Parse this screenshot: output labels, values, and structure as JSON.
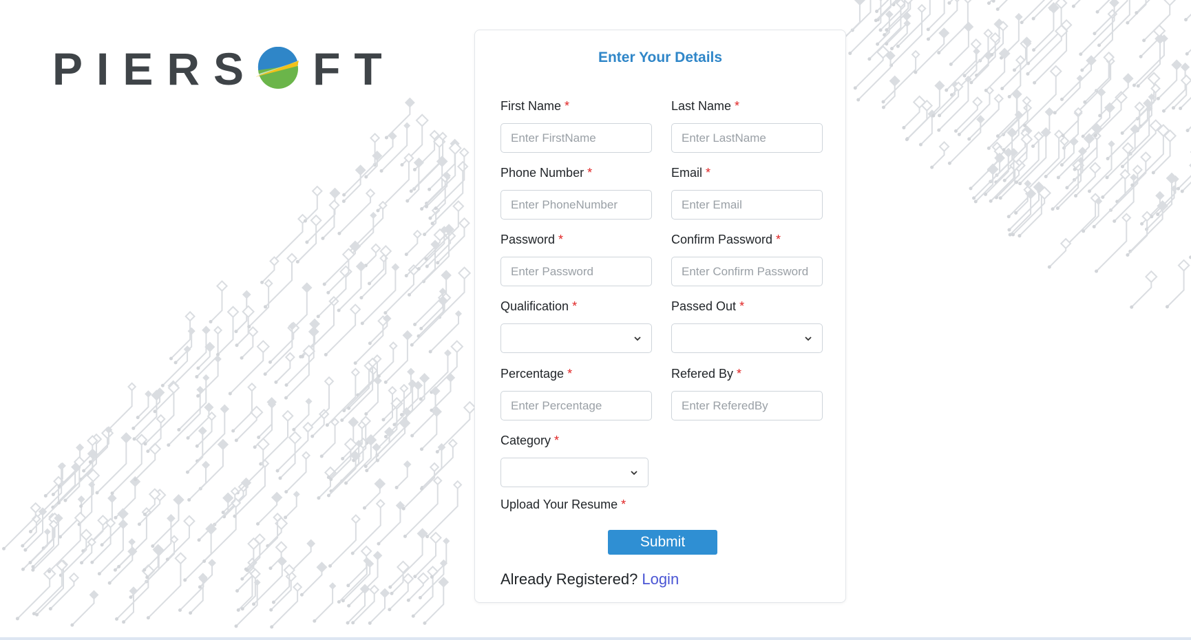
{
  "brand": {
    "logo_text_left": "PIERS",
    "logo_text_right": "FT",
    "colors": {
      "text": "#3f4448",
      "globe_blue": "#2f86c8",
      "globe_green": "#6bb54a",
      "swoosh": "#f2c21b"
    }
  },
  "form": {
    "title": "Enter Your Details",
    "required_marker": "*",
    "fields": {
      "first_name": {
        "label": "First Name",
        "placeholder": "Enter FirstName",
        "value": ""
      },
      "last_name": {
        "label": "Last Name",
        "placeholder": "Enter LastName",
        "value": ""
      },
      "phone_number": {
        "label": "Phone Number",
        "placeholder": "Enter PhoneNumber",
        "value": ""
      },
      "email": {
        "label": "Email",
        "placeholder": "Enter Email",
        "value": ""
      },
      "password": {
        "label": "Password",
        "placeholder": "Enter Password",
        "value": ""
      },
      "confirm_password": {
        "label": "Confirm Password",
        "placeholder": "Enter Confirm Password",
        "value": ""
      },
      "qualification": {
        "label": "Qualification",
        "selected": ""
      },
      "passed_out": {
        "label": "Passed Out",
        "selected": ""
      },
      "percentage": {
        "label": "Percentage",
        "placeholder": "Enter Percentage",
        "value": ""
      },
      "refered_by": {
        "label": "Refered By",
        "placeholder": "Enter ReferedBy",
        "value": ""
      },
      "category": {
        "label": "Category",
        "selected": ""
      },
      "resume": {
        "label": "Upload Your Resume"
      }
    },
    "submit_label": "Submit",
    "footer": {
      "prompt": "Already Registered?",
      "login_link": "Login"
    },
    "colors": {
      "title": "#2f86c8",
      "submit_bg": "#2f8fd3",
      "required": "#e02424",
      "link": "#4a55d4"
    }
  }
}
